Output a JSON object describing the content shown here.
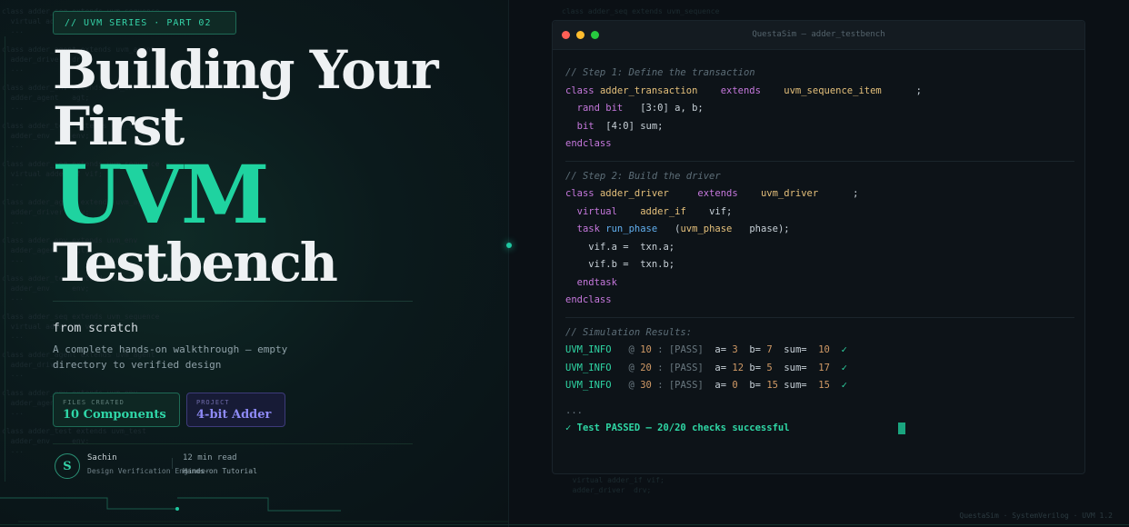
{
  "series_badge": "// UVM SERIES · PART 02",
  "title": {
    "line1": "Building Your",
    "line2": "First",
    "line3": "UVM",
    "line4": "Testbench"
  },
  "subtitle": "from scratch",
  "description": "A complete hands-on walkthrough — empty directory to verified design",
  "cards": {
    "files_label": "FILES CREATED",
    "files_value": "10 Components",
    "project_label": "PROJECT",
    "project_value": "4-bit Adder"
  },
  "author": {
    "initial": "S",
    "name": "Sachin",
    "role": "Design Verification Engineer",
    "read_time": "12 min read",
    "type": "Hands-on Tutorial"
  },
  "window": {
    "title": "QuestaSim — adder_testbench"
  },
  "code": {
    "step1_comment": "// Step 1: Define the transaction",
    "step1_class": "class",
    "step1_name": "adder_transaction",
    "step1_extends": "extends",
    "step1_base": "uvm_sequence_item",
    "step1_semi": ";",
    "step1_rand": "rand bit",
    "step1_range1": "[3:0] a, b;",
    "step1_bit": "bit",
    "step1_range2": "[4:0] sum;",
    "step1_end": "endclass",
    "step2_comment": "// Step 2: Build the driver",
    "step2_class": "class",
    "step2_name": "adder_driver",
    "step2_extends": "extends",
    "step2_base": "uvm_driver",
    "step2_semi": ";",
    "step2_virtual": "virtual",
    "step2_if": "adder_if",
    "step2_vif": "vif;",
    "step2_task": "task",
    "step2_fn": "run_phase",
    "step2_arg_open": "(",
    "step2_argtype": "uvm_phase",
    "step2_arg": "phase);",
    "step2_l1": "vif.a =  txn.a;",
    "step2_l2": "vif.b =  txn.b;",
    "step2_endtask": "endtask",
    "step2_end": "endclass",
    "sim_comment": "// Simulation Results:",
    "results": [
      {
        "tag": "UVM_INFO",
        "at": "@",
        "time": "10",
        "sep": ":",
        "status": "[PASS]",
        "a": "3",
        "b": "7",
        "sum": "10",
        "check": "✓"
      },
      {
        "tag": "UVM_INFO",
        "at": "@",
        "time": "20",
        "sep": ":",
        "status": "[PASS]",
        "a": "12",
        "b": "5",
        "sum": "17",
        "check": "✓"
      },
      {
        "tag": "UVM_INFO",
        "at": "@",
        "time": "30",
        "sep": ":",
        "status": "[PASS]",
        "a": "0",
        "b": "15",
        "sum": "15",
        "check": "✓"
      }
    ],
    "ellipsis": "...",
    "final": "✓ Test PASSED — 20/20 checks successful"
  },
  "footer": "QuestaSim · SystemVerilog · UVM 1.2",
  "colors": {
    "accent": "#1fd3a0",
    "project_accent": "#8e8af5",
    "background": "#0b1116"
  }
}
